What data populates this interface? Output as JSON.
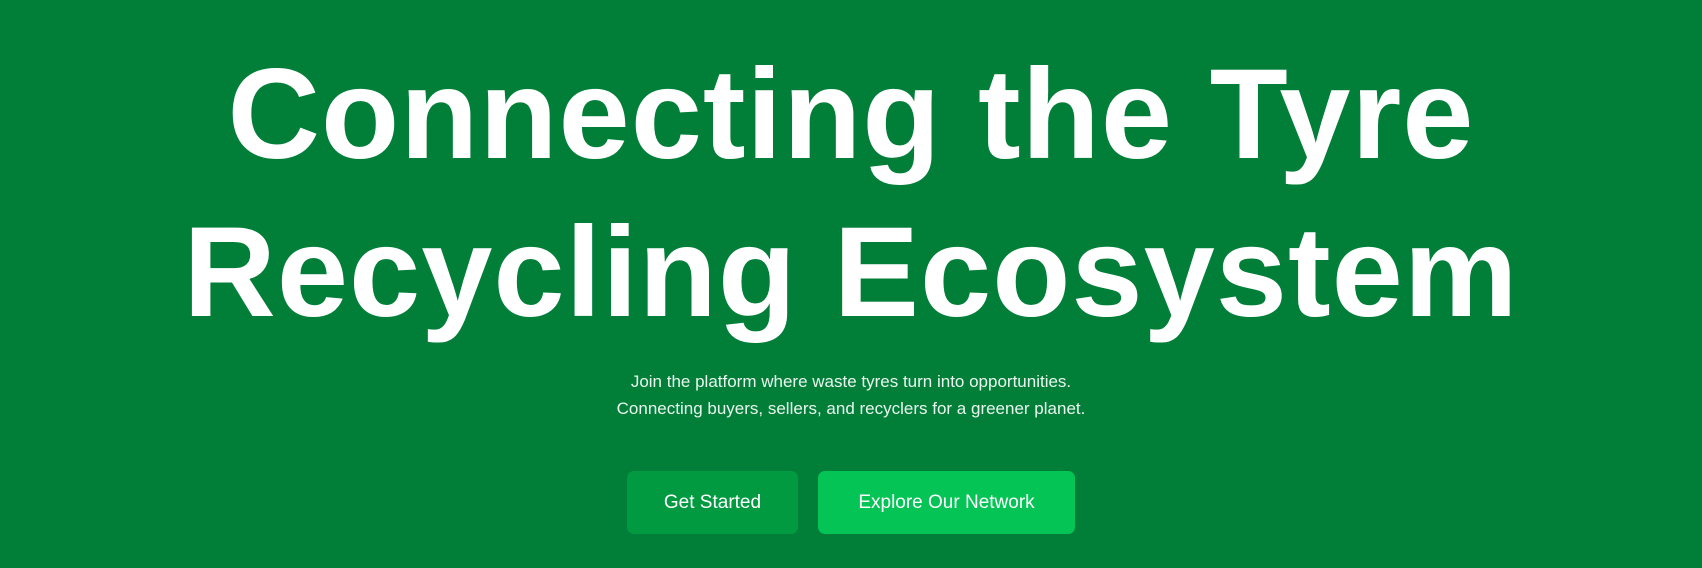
{
  "hero": {
    "title_line1": "Connecting the Tyre",
    "title_line2": "Recycling Ecosystem",
    "subtitle_line1": "Join the platform where waste tyres turn into opportunities.",
    "subtitle_line2": "Connecting buyers, sellers, and recyclers for a greener planet.",
    "primary_button": "Get Started",
    "secondary_button": "Explore Our Network"
  },
  "colors": {
    "background": "#017f39",
    "primary_button": "#019a41",
    "secondary_button": "#03c454",
    "text": "#ffffff"
  }
}
